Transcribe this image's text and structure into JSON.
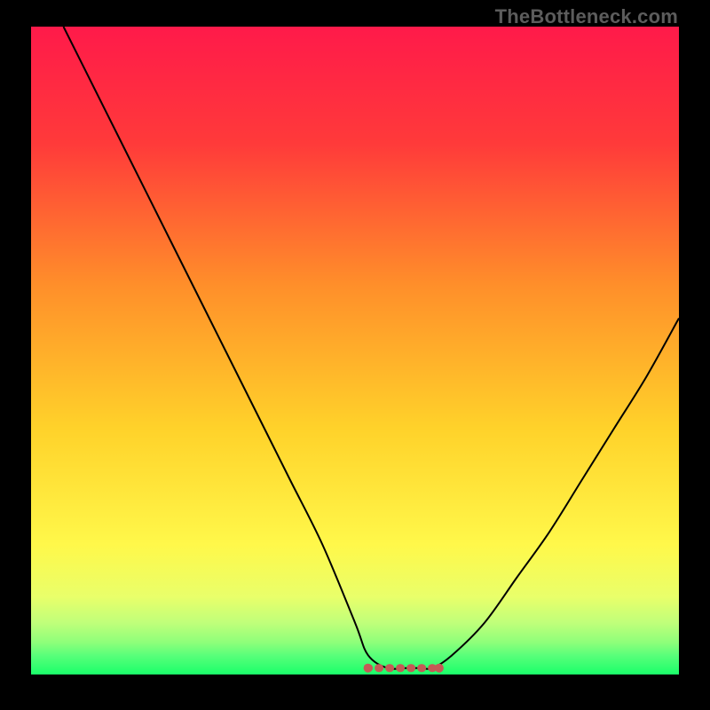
{
  "watermark": {
    "text": "TheBottleneck.com"
  },
  "colors": {
    "marker": "#c55a56",
    "curve": "#000000",
    "gradient_stops": [
      {
        "pct": 0,
        "color": "#ff1a4a"
      },
      {
        "pct": 18,
        "color": "#ff3a3a"
      },
      {
        "pct": 40,
        "color": "#ff8f2a"
      },
      {
        "pct": 62,
        "color": "#ffd22a"
      },
      {
        "pct": 80,
        "color": "#fff84a"
      },
      {
        "pct": 88,
        "color": "#e9ff6a"
      },
      {
        "pct": 92,
        "color": "#c0ff7a"
      },
      {
        "pct": 95,
        "color": "#8fff7a"
      },
      {
        "pct": 97,
        "color": "#5aff7a"
      },
      {
        "pct": 100,
        "color": "#1aff6a"
      }
    ]
  },
  "chart_data": {
    "type": "line",
    "title": "",
    "xlabel": "",
    "ylabel": "",
    "xlim": [
      0,
      100
    ],
    "ylim": [
      0,
      100
    ],
    "legend": false,
    "grid": false,
    "series": [
      {
        "name": "bottleneck-curve",
        "x": [
          5,
          10,
          15,
          20,
          25,
          30,
          35,
          40,
          45,
          50,
          52,
          55,
          58,
          60,
          62,
          65,
          70,
          75,
          80,
          85,
          90,
          95,
          100
        ],
        "y": [
          100,
          90,
          80,
          70,
          60,
          50,
          40,
          30,
          20,
          8,
          3,
          1,
          1,
          1,
          1,
          3,
          8,
          15,
          22,
          30,
          38,
          46,
          55
        ]
      }
    ],
    "annotations": [
      {
        "kind": "flat-region-marker",
        "x_start": 52,
        "x_end": 63,
        "y": 1
      }
    ]
  }
}
